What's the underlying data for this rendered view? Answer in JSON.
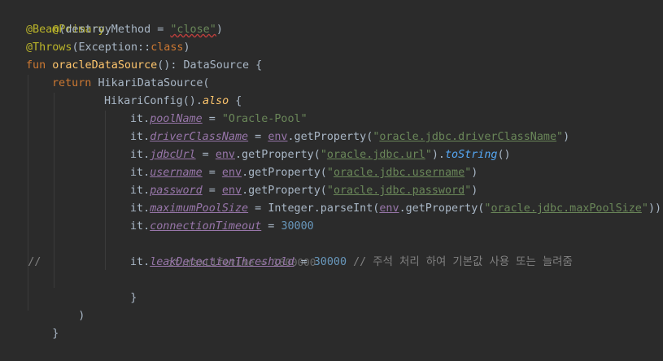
{
  "code": {
    "l1_ann": "@Primary",
    "l2_ann": "@Bean",
    "l2_open": "(destroyMethod = ",
    "l2_str": "\"close\"",
    "l2_close": ")",
    "l3_ann": "@Throws",
    "l3_rest": "(Exception::",
    "l3_kw": "class",
    "l3_close": ")",
    "l4_kw": "fun ",
    "l4_fn": "oracleDataSource",
    "l4_rest": "(): DataSource {",
    "l5_kw": "return ",
    "l5_rest": "HikariDataSource(",
    "l6_rest": "HikariConfig().",
    "l6_ext": "also",
    "l6_brace": " {",
    "it": "it.",
    "eq": " = ",
    "p1": "poolName",
    "v1": "\"Oracle-Pool\"",
    "p2": "driverClassName",
    "p3": "jdbcUrl",
    "p4": "username",
    "p5": "password",
    "p6": "maximumPoolSize",
    "p7": "connectionTimeout",
    "p8": "leakDetectionThreshold",
    "env": "env",
    "getprop": ".getProperty(",
    "k2": "oracle.jdbc.driverClassName",
    "k3": "oracle.jdbc.url",
    "k4": "oracle.jdbc.username",
    "k5": "oracle.jdbc.password",
    "k6": "oracle.jdbc.maxPoolSize",
    "q": "\"",
    "tostring": "toString",
    "close_paren": ")",
    "l3_dot": ").",
    "parens": "()",
    "intparse": "Integer.parseInt(",
    "dbl_close": "))",
    "v7": "30000",
    "c_slashes": "//",
    "c_text": "it.maxLifetime = 1800000",
    "v8": "30000",
    "v8_comment": " // 주석 처리 하여 기본값 사용 또는 늘려줌",
    "brace_close": "}",
    "paren_close": ")",
    "outer_close": "}"
  }
}
